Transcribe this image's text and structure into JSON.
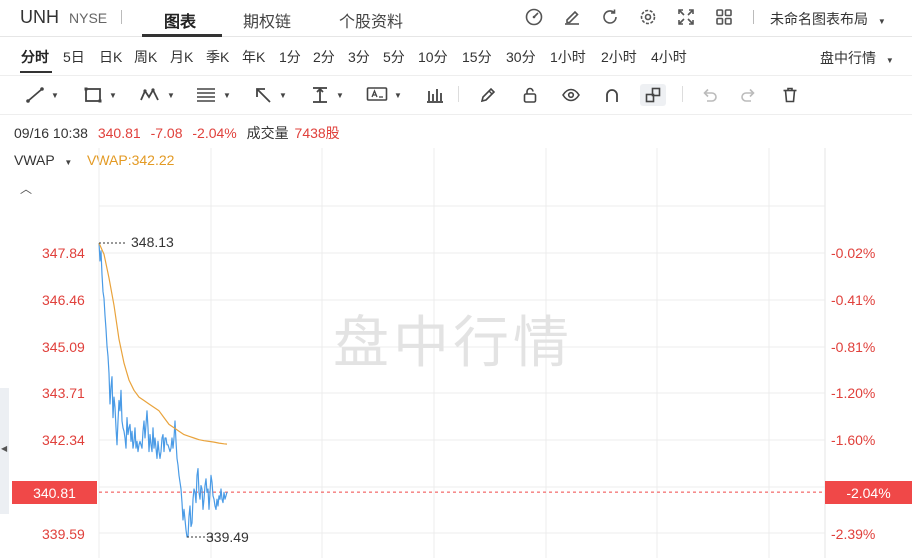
{
  "header": {
    "symbol": "UNH",
    "exchange": "NYSE",
    "tabs": [
      "图表",
      "期权链",
      "个股资料"
    ],
    "active_tab": "图表",
    "layout_label": "未命名图表布局",
    "icons": [
      "gauge-icon",
      "edit-icon",
      "refresh-icon",
      "settings-icon",
      "fullscreen-icon",
      "grid-icon"
    ]
  },
  "periods": {
    "items": [
      "分时",
      "5日",
      "日K",
      "周K",
      "月K",
      "季K",
      "年K",
      "1分",
      "2分",
      "3分",
      "5分",
      "10分",
      "15分",
      "30分",
      "1小时",
      "2小时",
      "4小时"
    ],
    "active": "分时",
    "mode_label": "盘中行情"
  },
  "toolbar": {
    "tools": [
      "line-tool-icon",
      "rectangle-tool-icon",
      "pattern-tool-icon",
      "fib-tool-icon",
      "arrow-tool-icon",
      "measure-tool-icon",
      "text-tool-icon",
      "bars-icon",
      "pen-icon",
      "lock-icon",
      "eye-icon",
      "magnet-icon",
      "link-icon",
      "undo-icon",
      "redo-icon",
      "trash-icon"
    ]
  },
  "info": {
    "datetime": "09/16 10:38",
    "price": "340.81",
    "change": "-7.08",
    "change_pct": "-2.04%",
    "volume_label": "成交量",
    "volume": "7438股"
  },
  "indicator": {
    "name": "VWAP",
    "value_text": "VWAP:342.22"
  },
  "watermark": "盘中行情",
  "colors": {
    "price_line": "#4a9be6",
    "vwap_line": "#e9a33c",
    "down": "#e0403b",
    "current_bg": "#f04848"
  },
  "chart_data": {
    "type": "line",
    "y_left_ticks": [
      "347.84",
      "346.46",
      "345.09",
      "343.71",
      "342.34",
      "339.59"
    ],
    "y_right_ticks": [
      "-0.02%",
      "-0.41%",
      "-0.81%",
      "-1.20%",
      "-1.60%",
      "-2.39%"
    ],
    "current_price": "340.81",
    "current_pct": "-2.04%",
    "high_label": "348.13",
    "low_label": "339.49",
    "ylim": [
      339.3,
      348.6
    ],
    "grid": true,
    "series": [
      {
        "x": [
          0,
          1,
          2,
          3,
          4,
          5,
          6,
          7,
          8,
          9,
          10,
          11,
          12,
          13,
          14,
          15,
          16,
          17,
          18,
          19,
          20,
          21,
          22,
          23,
          24,
          25,
          26,
          27,
          28,
          29,
          30,
          31,
          32,
          33,
          34,
          35,
          36,
          37,
          38,
          39,
          40,
          41,
          42,
          43,
          44,
          45,
          46,
          47,
          48,
          49,
          50,
          51,
          52,
          53,
          54,
          55,
          56,
          57,
          58,
          59,
          60,
          61,
          62,
          63,
          64,
          65,
          66,
          67,
          68,
          69,
          70,
          71,
          72,
          73,
          74,
          75,
          76,
          77,
          78,
          79,
          80,
          81,
          82,
          83,
          84,
          85,
          86,
          87,
          88,
          89,
          90,
          91,
          92,
          93,
          94,
          95,
          96,
          97,
          98,
          99,
          100,
          101,
          102,
          103,
          104,
          105,
          106,
          107,
          108,
          109,
          110,
          111,
          112,
          113,
          114,
          115,
          116,
          117,
          118,
          119,
          120,
          121,
          122,
          123,
          124,
          125,
          126,
          127,
          128
        ],
        "y": [
          348.13,
          347.6,
          347.9,
          347.2,
          346.7,
          346.5,
          346.0,
          345.6,
          345.1,
          344.8,
          344.3,
          343.4,
          343.9,
          344.2,
          343.0,
          343.6,
          343.3,
          342.7,
          342.2,
          342.9,
          343.5,
          343.2,
          343.8,
          342.9,
          342.7,
          342.6,
          342.4,
          342.1,
          343.0,
          342.5,
          342.7,
          342.8,
          342.3,
          342.6,
          342.1,
          342.3,
          342.7,
          342.1,
          342.3,
          342.0,
          342.2,
          342.3,
          342.2,
          342.1,
          342.6,
          342.9,
          342.4,
          342.8,
          343.2,
          342.7,
          342.0,
          342.5,
          342.2,
          342.0,
          342.7,
          342.1,
          342.4,
          342.1,
          341.8,
          342.3,
          342.0,
          341.8,
          342.0,
          342.4,
          342.5,
          342.0,
          342.4,
          342.4,
          342.2,
          342.2,
          342.1,
          342.0,
          342.1,
          342.4,
          342.1,
          342.4,
          342.9,
          342.3,
          341.8,
          341.6,
          341.3,
          341.1,
          340.9,
          340.5,
          339.99,
          340.3,
          340.0,
          339.7,
          339.49,
          339.5,
          340.1,
          340.4,
          339.8,
          339.9,
          340.6,
          340.9,
          340.8,
          340.5,
          341.3,
          341.5,
          340.8,
          340.6,
          341.0,
          340.9,
          340.3,
          340.6,
          341.0,
          341.2,
          340.8,
          340.9,
          340.3,
          340.8,
          341.3,
          341.1,
          340.7,
          340.6,
          340.4,
          340.3,
          340.6,
          340.4,
          340.7,
          340.6,
          340.9,
          340.6,
          340.5,
          340.8,
          340.6,
          340.7,
          340.81
        ],
        "name": "price"
      },
      {
        "x": [
          0,
          5,
          10,
          15,
          20,
          25,
          30,
          35,
          40,
          45,
          50,
          55,
          60,
          65,
          70,
          75,
          80,
          85,
          90,
          95,
          100,
          105,
          110,
          115,
          120,
          125,
          128
        ],
        "y": [
          348.13,
          347.8,
          347.1,
          346.3,
          345.3,
          344.6,
          344.1,
          343.8,
          343.6,
          343.5,
          343.4,
          343.3,
          343.2,
          343.0,
          342.8,
          342.7,
          342.6,
          342.5,
          342.45,
          342.4,
          342.35,
          342.32,
          342.3,
          342.28,
          342.25,
          342.23,
          342.22
        ],
        "name": "VWAP"
      }
    ]
  }
}
